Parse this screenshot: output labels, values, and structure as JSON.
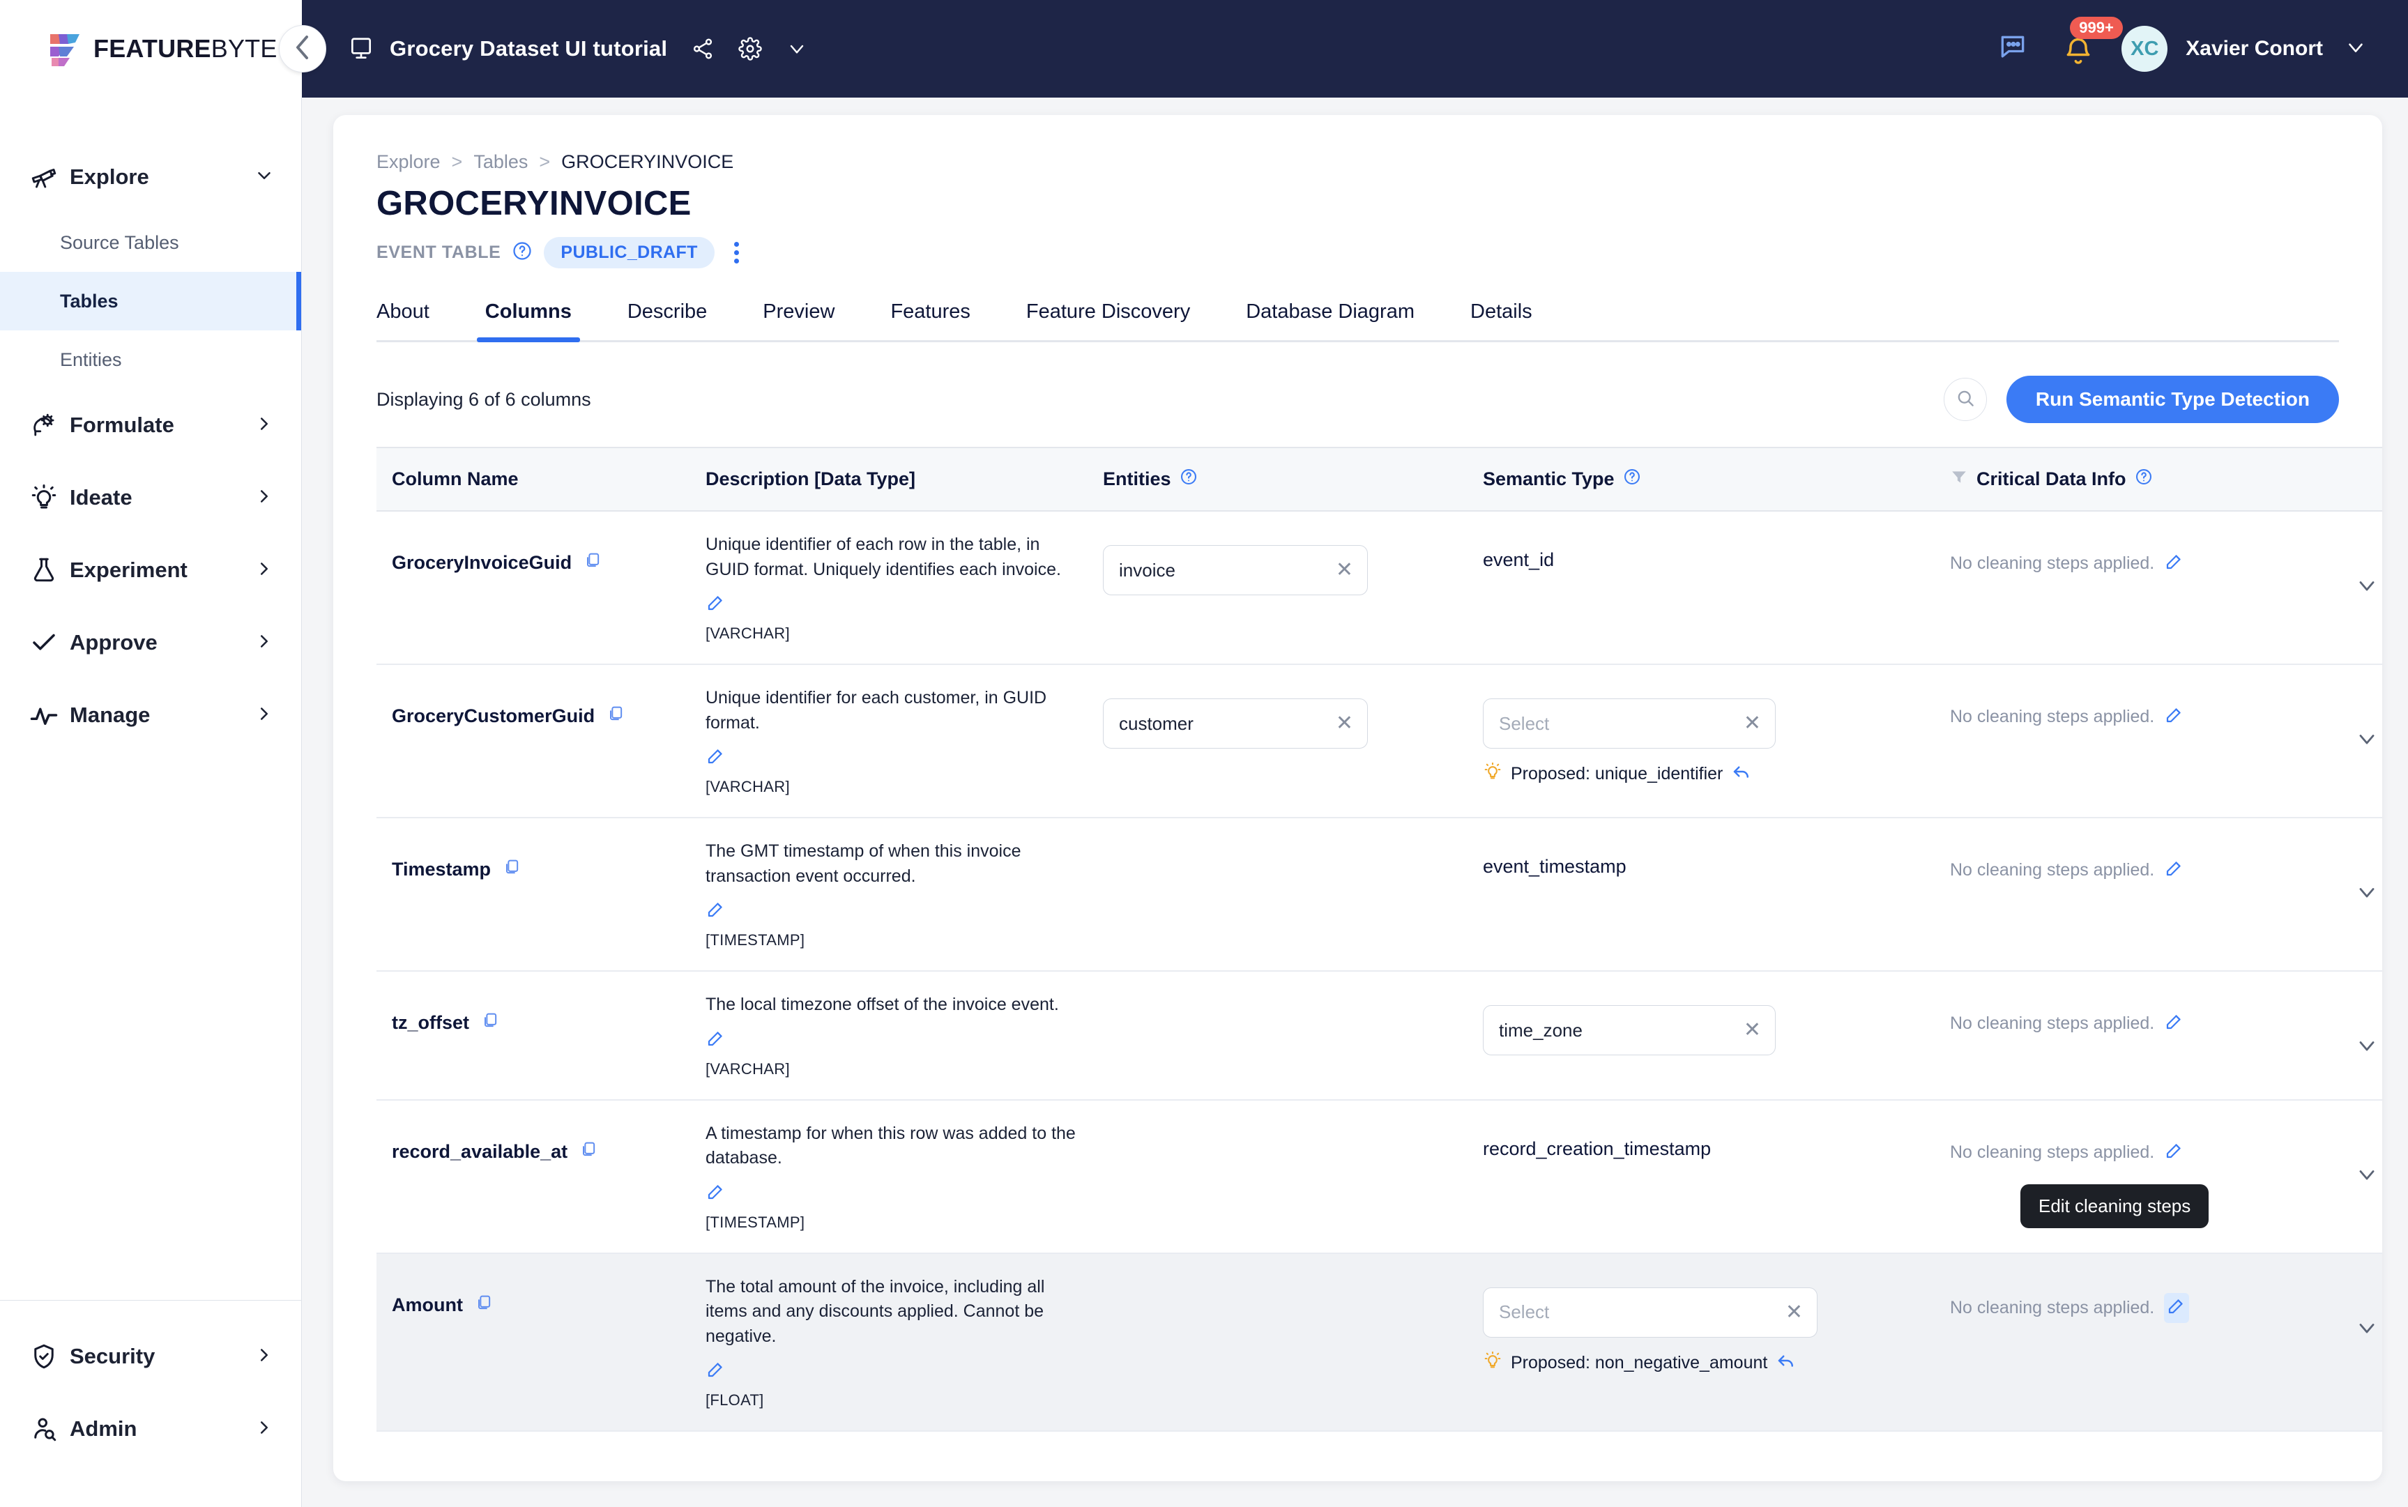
{
  "brand": {
    "name_bold": "FEATURE",
    "name_light": "BYTE"
  },
  "topbar": {
    "project_title": "Grocery Dataset UI tutorial",
    "share_icon": "share-icon",
    "settings_icon": "gear-icon",
    "caret_icon": "chevron-down-icon",
    "chat_icon": "chat-bubble-icon",
    "bell_icon": "bell-icon",
    "notification_badge": "999+",
    "avatar_initials": "XC",
    "user_name": "Xavier Conort",
    "collapse_icon": "chevron-left-icon",
    "monitor_icon": "monitor-icon",
    "bar_color": "#1e2547"
  },
  "sidebar": {
    "groups": [
      {
        "label": "Explore",
        "icon": "telescope-icon",
        "expanded": true,
        "caret": "chevron-down-icon"
      },
      {
        "label": "Formulate",
        "icon": "brain-gear-icon",
        "expanded": false,
        "caret": "chevron-right-icon"
      },
      {
        "label": "Ideate",
        "icon": "lightbulb-icon",
        "expanded": false,
        "caret": "chevron-right-icon"
      },
      {
        "label": "Experiment",
        "icon": "flask-icon",
        "expanded": false,
        "caret": "chevron-right-icon"
      },
      {
        "label": "Approve",
        "icon": "check-icon",
        "expanded": false,
        "caret": "chevron-right-icon"
      },
      {
        "label": "Manage",
        "icon": "activity-pulse-icon",
        "expanded": false,
        "caret": "chevron-right-icon"
      }
    ],
    "explore_items": [
      {
        "label": "Source Tables",
        "active": false
      },
      {
        "label": "Tables",
        "active": true
      },
      {
        "label": "Entities",
        "active": false
      }
    ],
    "bottom": [
      {
        "label": "Security",
        "icon": "shield-check-icon",
        "caret": "chevron-right-icon"
      },
      {
        "label": "Admin",
        "icon": "user-search-icon",
        "caret": "chevron-right-icon"
      }
    ],
    "active_accent": "#2f6ef0",
    "active_bg": "#e9f2fd"
  },
  "page": {
    "breadcrumb": [
      "Explore",
      "Tables",
      "GROCERYINVOICE"
    ],
    "breadcrumb_separator": ">",
    "title": "GROCERYINVOICE",
    "type_label": "EVENT TABLE",
    "help_icon": "question-circle-icon",
    "status_pill": "PUBLIC_DRAFT",
    "more_icon": "kebab-menu-icon"
  },
  "tabs": [
    {
      "label": "About",
      "active": false
    },
    {
      "label": "Columns",
      "active": true
    },
    {
      "label": "Describe",
      "active": false
    },
    {
      "label": "Preview",
      "active": false
    },
    {
      "label": "Features",
      "active": false
    },
    {
      "label": "Feature Discovery",
      "active": false
    },
    {
      "label": "Database Diagram",
      "active": false
    },
    {
      "label": "Details",
      "active": false
    }
  ],
  "toolbar": {
    "count_text": "Displaying 6 of 6 columns",
    "search_icon": "search-icon",
    "run_detection_label": "Run Semantic Type Detection",
    "primary_color": "#3b7bf5"
  },
  "table": {
    "headers": [
      {
        "label": "Column Name",
        "help": false
      },
      {
        "label": "Description [Data Type]",
        "help": false
      },
      {
        "label": "Entities",
        "help": true
      },
      {
        "label": "Semantic Type",
        "help": true
      },
      {
        "label": "Critical Data Info",
        "help": true,
        "filter_icon": "filter-icon"
      }
    ],
    "copy_icon": "copy-icon",
    "edit_icon": "pencil-edit-icon",
    "clear_icon": "close-x-icon",
    "revert_icon": "undo-arrow-icon",
    "bulb_icon": "lightbulb-idea-icon",
    "expand_icon": "chevron-down-icon",
    "select_placeholder": "Select",
    "rows": [
      {
        "name": "GroceryInvoiceGuid",
        "description": "Unique identifier of each row in the table, in GUID format. Uniquely identifies each invoice.",
        "data_type": "[VARCHAR]",
        "entity": "invoice",
        "entity_mode": "chip",
        "semantic_type": "event_id",
        "semantic_mode": "text",
        "proposed": null,
        "critical_data_info": "No cleaning steps applied.",
        "highlighted": false
      },
      {
        "name": "GroceryCustomerGuid",
        "description": "Unique identifier for each customer, in GUID format.",
        "data_type": "[VARCHAR]",
        "entity": "customer",
        "entity_mode": "chip",
        "semantic_type": "",
        "semantic_mode": "select",
        "proposed": "Proposed: unique_identifier",
        "critical_data_info": "No cleaning steps applied.",
        "highlighted": false
      },
      {
        "name": "Timestamp",
        "description": "The GMT timestamp of when this invoice transaction event occurred.",
        "data_type": "[TIMESTAMP]",
        "entity": null,
        "entity_mode": "none",
        "semantic_type": "event_timestamp",
        "semantic_mode": "text",
        "proposed": null,
        "critical_data_info": "No cleaning steps applied.",
        "highlighted": false
      },
      {
        "name": "tz_offset",
        "description": "The local timezone offset of the invoice event.",
        "data_type": "[VARCHAR]",
        "entity": null,
        "entity_mode": "none",
        "semantic_type": "time_zone",
        "semantic_mode": "chip",
        "proposed": null,
        "critical_data_info": "No cleaning steps applied.",
        "highlighted": false
      },
      {
        "name": "record_available_at",
        "description": "A timestamp for when this row was added to the database.",
        "data_type": "[TIMESTAMP]",
        "entity": null,
        "entity_mode": "none",
        "semantic_type": "record_creation_timestamp",
        "semantic_mode": "text",
        "proposed": null,
        "critical_data_info": "No cleaning steps applied.",
        "highlighted": false
      },
      {
        "name": "Amount",
        "description": "The total amount of the invoice, including all items and any discounts applied. Cannot be negative.",
        "data_type": "[FLOAT]",
        "entity": null,
        "entity_mode": "none",
        "semantic_type": "",
        "semantic_mode": "select",
        "proposed": "Proposed: non_negative_amount",
        "critical_data_info": "No cleaning steps applied.",
        "highlighted": true
      }
    ]
  },
  "tooltip": {
    "text": "Edit cleaning steps",
    "bg": "#1d2026"
  }
}
